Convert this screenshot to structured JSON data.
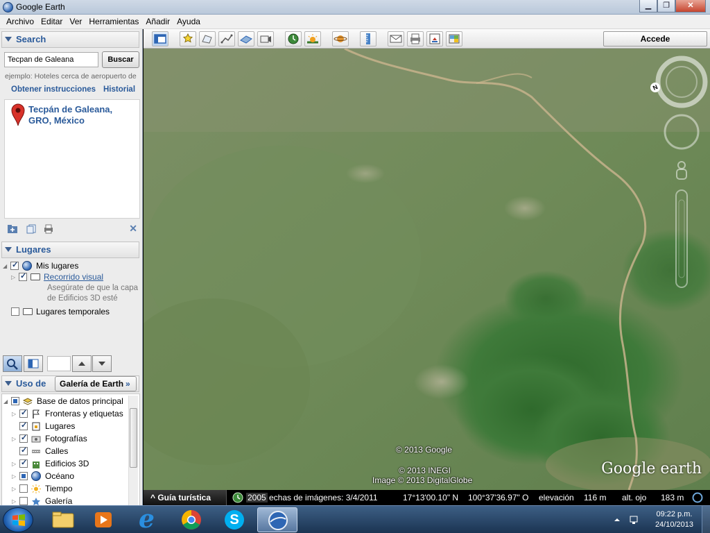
{
  "window": {
    "title": "Google Earth",
    "min_glyph": "▁",
    "max_glyph": "❐",
    "close_glyph": "✕"
  },
  "menu": [
    "Archivo",
    "Editar",
    "Ver",
    "Herramientas",
    "Añadir",
    "Ayuda"
  ],
  "search": {
    "header": "Search",
    "input_value": "Tecpan de Galeana",
    "button_label": "Buscar",
    "example": "ejemplo: Hoteles cerca de aeropuerto de",
    "directions_link": "Obtener instrucciones",
    "history_link": "Historial",
    "result_name": "Tecpán de Galeana, GRO, México",
    "close_glyph": "✕"
  },
  "places": {
    "header": "Lugares",
    "items": [
      {
        "label": "Mis lugares"
      },
      {
        "label": "Recorrido visual",
        "note_line1": "Asegúrate de que la capa",
        "note_line2": "de Edificios 3D esté"
      },
      {
        "label": "Lugares temporales"
      }
    ]
  },
  "layers": {
    "header": "Uso de",
    "gallery_button": "Galería de Earth",
    "gallery_chevron": "»",
    "items": [
      {
        "label": "Base de datos principal"
      },
      {
        "label": "Fronteras y etiquetas"
      },
      {
        "label": "Lugares"
      },
      {
        "label": "Fotografías"
      },
      {
        "label": "Calles"
      },
      {
        "label": "Edificios 3D"
      },
      {
        "label": "Océano"
      },
      {
        "label": "Tiempo"
      },
      {
        "label": "Galería"
      }
    ]
  },
  "toolbar": {
    "sign_in": "Accede"
  },
  "map": {
    "credit_google": "© 2013 Google",
    "credit_inegi": "© 2013 INEGI",
    "credit_image": "Image © 2013 DigitalGlobe",
    "logo": "Google earth",
    "compass_north": "N"
  },
  "status": {
    "tour": "Guía turística",
    "year": "2005",
    "imagery_date": "echas de imágenes: 3/4/2011",
    "lat": "17°13'00.10\" N",
    "lon": "100°37'36.97\" O",
    "elevation_label": "elevación",
    "elevation_value": "116 m",
    "eye_alt_label": "alt. ojo",
    "eye_alt_value": "183 m"
  },
  "taskbar": {
    "time": "09:22 p.m.",
    "date": "24/10/2013",
    "ie_glyph": "e",
    "skype_glyph": "S"
  },
  "colors": {
    "accent": "#2a5a9a",
    "terrain": "#6f8a5a",
    "vegetation": "#3f7a3a",
    "path": "#c7b38c"
  }
}
